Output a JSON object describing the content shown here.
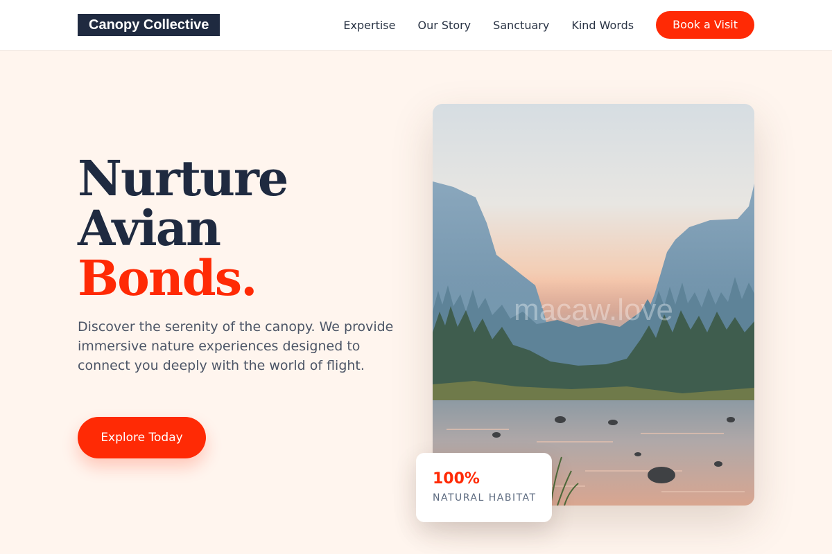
{
  "header": {
    "logo": "Canopy Collective",
    "nav": [
      "Expertise",
      "Our Story",
      "Sanctuary",
      "Kind Words"
    ],
    "cta_label": "Book a Visit"
  },
  "hero": {
    "title_line1": "Nurture",
    "title_line2": "Avian",
    "title_line3": "Bonds.",
    "description": "Discover the serenity of the canopy. We provide immersive nature experiences designed to connect you deeply with the world of flight.",
    "cta_label": "Explore Today"
  },
  "photo": {
    "watermark": "macaw.love"
  },
  "stat": {
    "value": "100%",
    "label": "NATURAL HABITAT"
  },
  "colors": {
    "accent": "#ff2a05",
    "navy": "#1f2a40",
    "background": "#fff5ee"
  }
}
